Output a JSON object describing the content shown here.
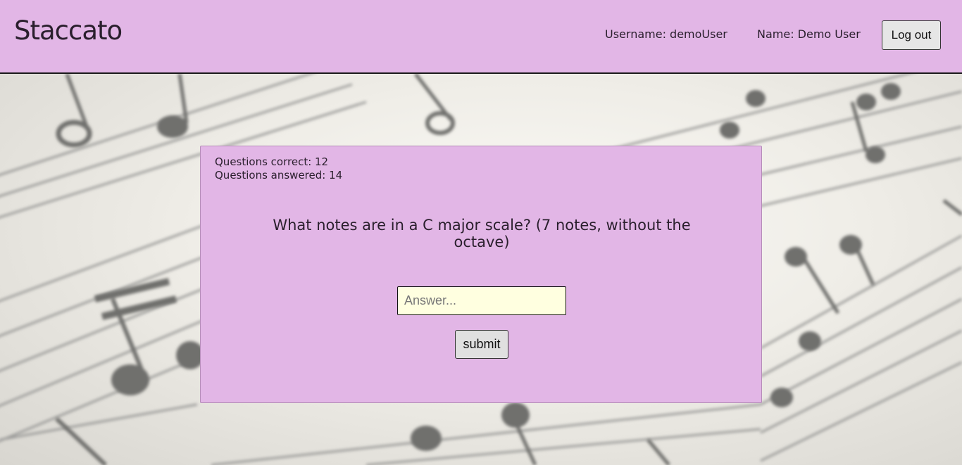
{
  "header": {
    "brand": "Staccato",
    "username_text": "Username: demoUser",
    "name_text": "Name: Demo User",
    "logout_label": "Log out"
  },
  "quiz": {
    "correct_text": "Questions correct: 12",
    "answered_text": "Questions answered: 14",
    "question": "What notes are in a C major scale? (7 notes, without the octave)",
    "answer_placeholder": "Answer...",
    "answer_value": "",
    "submit_label": "submit"
  },
  "colors": {
    "header_bg": "#e2b6e6",
    "card_bg": "#e2b6e6",
    "input_bg": "#ffffe0"
  },
  "icons": {
    "background": "sheet-music-illustration"
  }
}
